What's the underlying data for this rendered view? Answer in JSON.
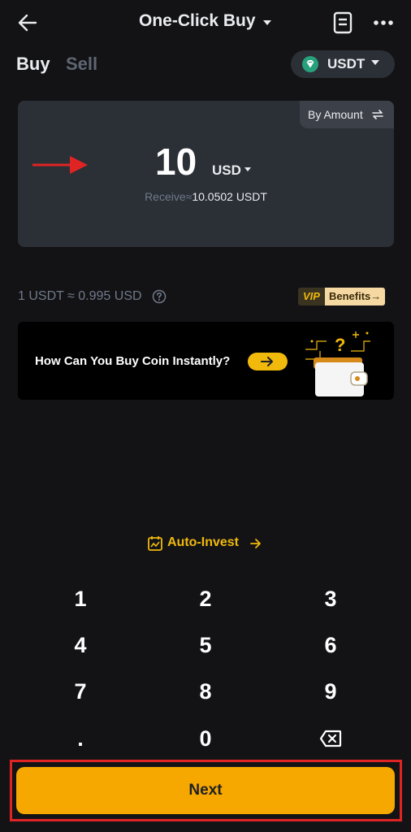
{
  "header": {
    "title": "One-Click Buy"
  },
  "tabs": {
    "buy": "Buy",
    "sell": "Sell"
  },
  "coin_selector": {
    "selected": "USDT",
    "icon": "tether-logo",
    "color": "#26a17b"
  },
  "amount_card": {
    "mode_label": "By Amount",
    "amount": "10",
    "currency": "USD",
    "receive_label": "Receive≈",
    "receive_value": "10.0502 USDT"
  },
  "rate": {
    "text": "1 USDT ≈ 0.995 USD",
    "vip_label": "VIP",
    "benefits_label": "Benefits→"
  },
  "promo": {
    "text": "How Can You Buy Coin Instantly?"
  },
  "auto_invest": {
    "label": "Auto-Invest"
  },
  "keypad": {
    "keys": [
      "1",
      "2",
      "3",
      "4",
      "5",
      "6",
      "7",
      "8",
      "9",
      ".",
      "0"
    ]
  },
  "next_button": {
    "label": "Next"
  },
  "colors": {
    "accent": "#f0b90b",
    "button": "#f6a700",
    "annotation": "#e02424",
    "background": "#131316",
    "card": "#2b2f36"
  }
}
